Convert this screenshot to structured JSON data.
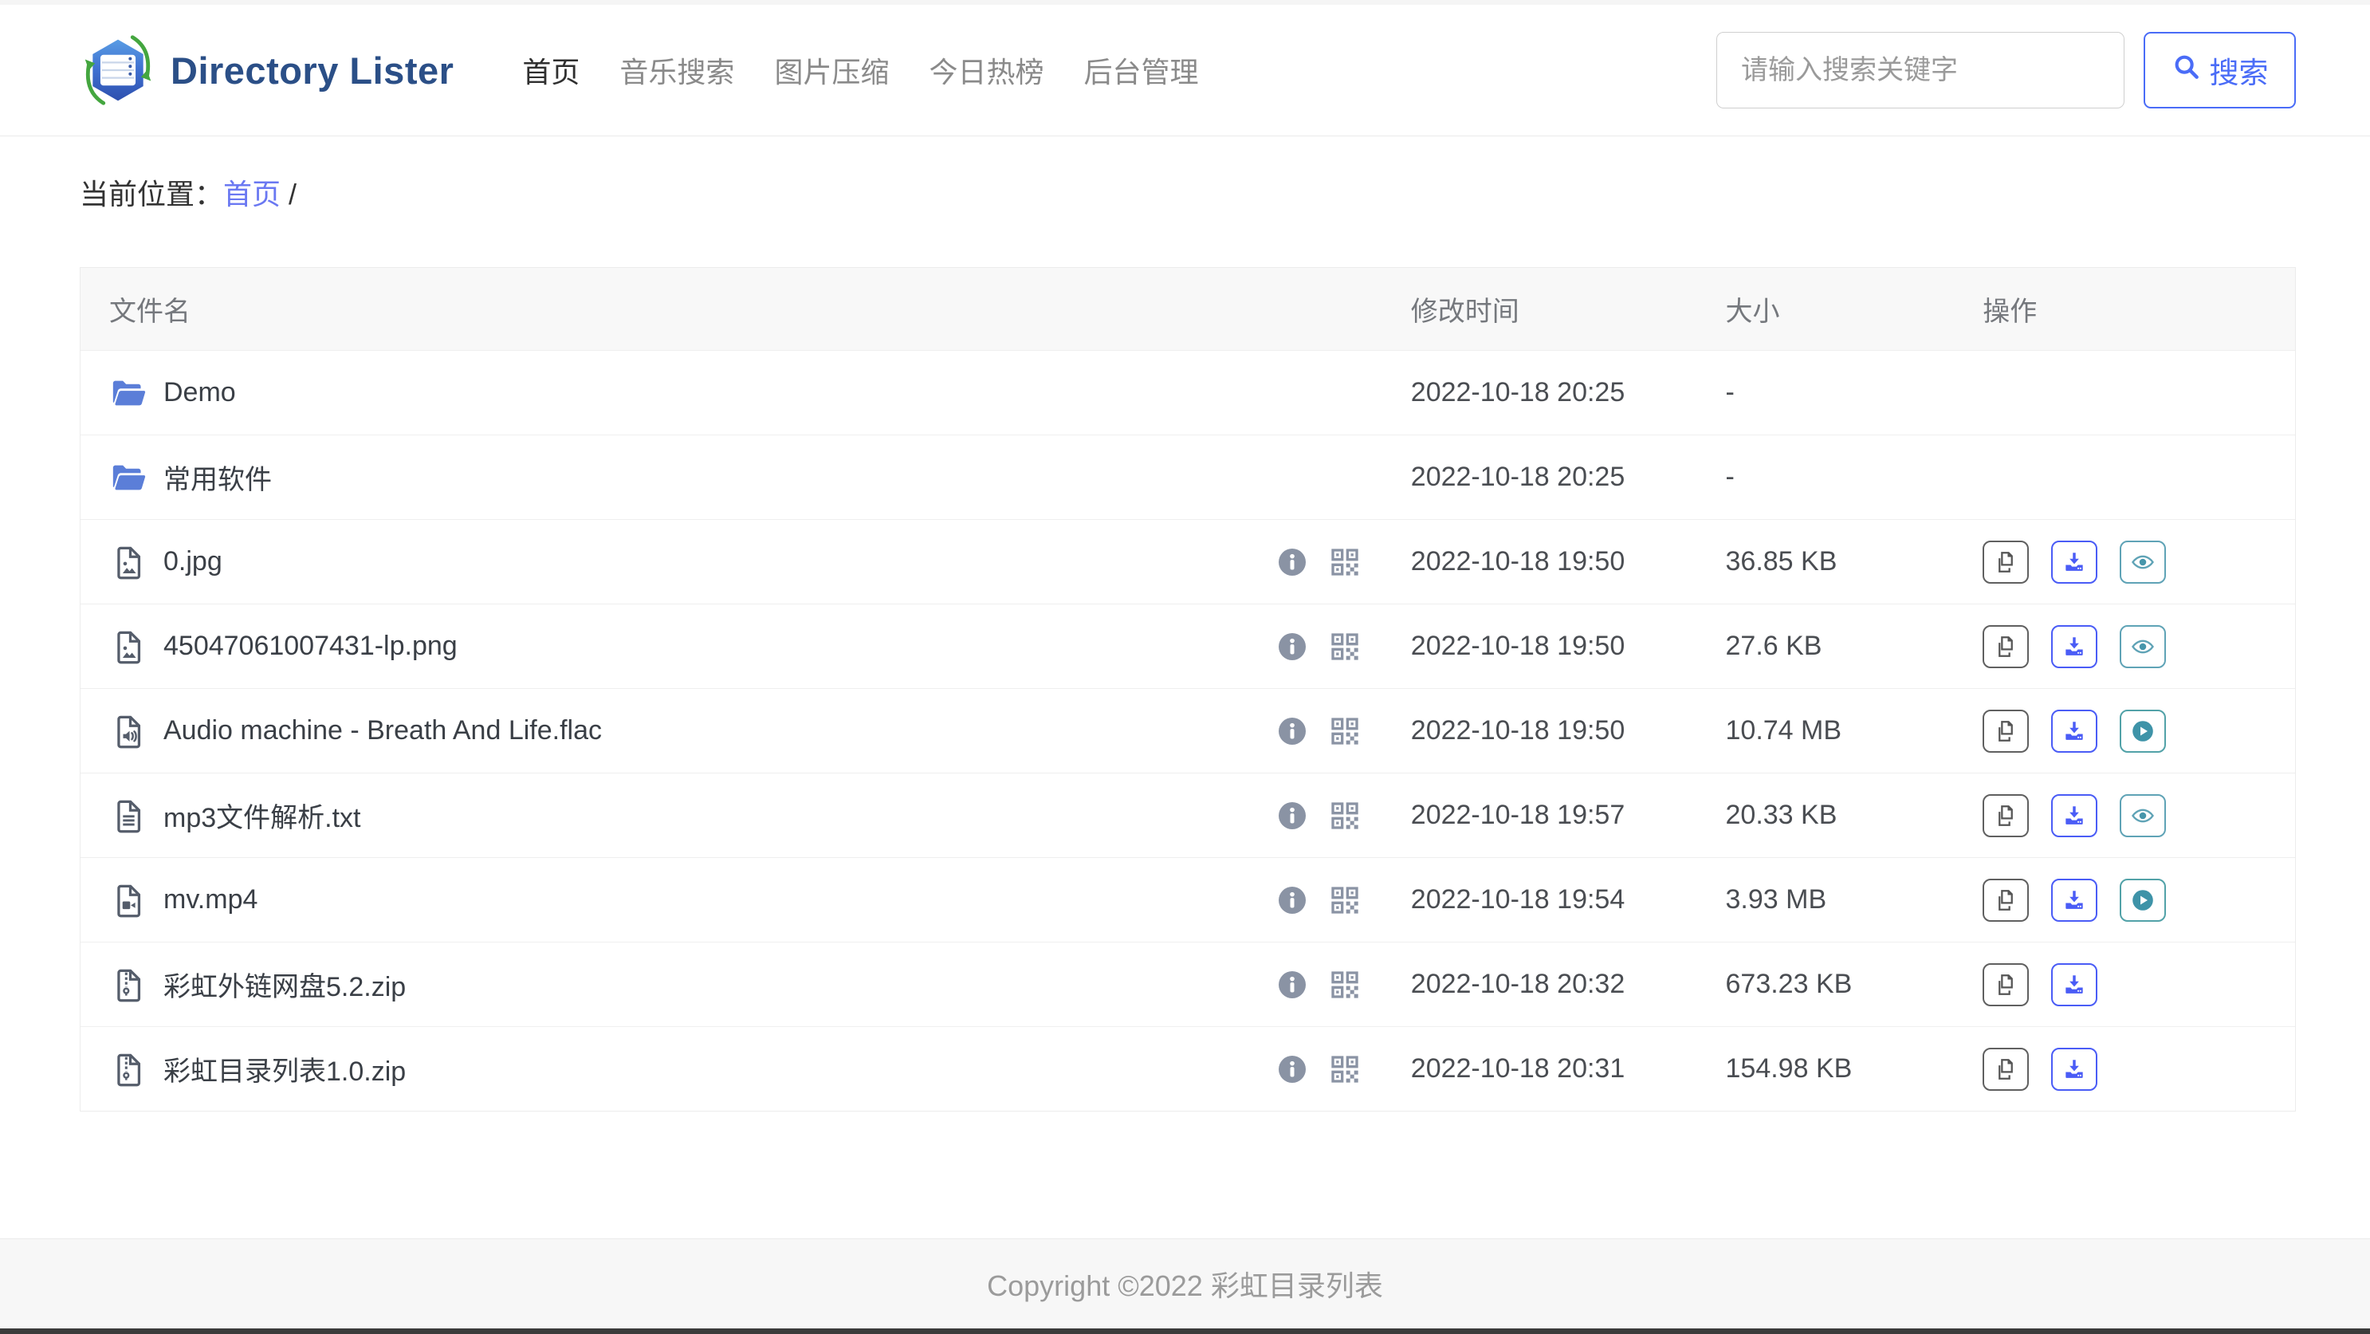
{
  "brand": {
    "name": "Directory Lister"
  },
  "nav": {
    "items": [
      {
        "label": "首页",
        "name": "nav-item-home",
        "active": true
      },
      {
        "label": "音乐搜索",
        "name": "nav-item-music-search",
        "active": false
      },
      {
        "label": "图片压缩",
        "name": "nav-item-image-compress",
        "active": false
      },
      {
        "label": "今日热榜",
        "name": "nav-item-hot-list",
        "active": false
      },
      {
        "label": "后台管理",
        "name": "nav-item-admin",
        "active": false
      }
    ]
  },
  "search": {
    "placeholder": "请输入搜索关键字",
    "button_label": "搜索"
  },
  "breadcrumb": {
    "prefix": "当前位置：",
    "home": "首页",
    "separator": "/"
  },
  "table": {
    "headers": {
      "name": "文件名",
      "modified": "修改时间",
      "size": "大小",
      "actions": "操作"
    },
    "rows": [
      {
        "icon": "folder",
        "name": "Demo",
        "modified": "2022-10-18 20:25",
        "size": "-",
        "badges": false,
        "actions": []
      },
      {
        "icon": "folder",
        "name": "常用软件",
        "modified": "2022-10-18 20:25",
        "size": "-",
        "badges": false,
        "actions": []
      },
      {
        "icon": "image",
        "name": "0.jpg",
        "modified": "2022-10-18 19:50",
        "size": "36.85 KB",
        "badges": true,
        "actions": [
          "copy",
          "download",
          "view"
        ]
      },
      {
        "icon": "image",
        "name": "45047061007431-lp.png",
        "modified": "2022-10-18 19:50",
        "size": "27.6 KB",
        "badges": true,
        "actions": [
          "copy",
          "download",
          "view"
        ]
      },
      {
        "icon": "audio",
        "name": "Audio machine - Breath And Life.flac",
        "modified": "2022-10-18 19:50",
        "size": "10.74 MB",
        "badges": true,
        "actions": [
          "copy",
          "download",
          "play"
        ]
      },
      {
        "icon": "text",
        "name": "mp3文件解析.txt",
        "modified": "2022-10-18 19:57",
        "size": "20.33 KB",
        "badges": true,
        "actions": [
          "copy",
          "download",
          "view"
        ]
      },
      {
        "icon": "video",
        "name": "mv.mp4",
        "modified": "2022-10-18 19:54",
        "size": "3.93 MB",
        "badges": true,
        "actions": [
          "copy",
          "download",
          "play"
        ]
      },
      {
        "icon": "zip",
        "name": "彩虹外链网盘5.2.zip",
        "modified": "2022-10-18 20:32",
        "size": "673.23 KB",
        "badges": true,
        "actions": [
          "copy",
          "download"
        ]
      },
      {
        "icon": "zip",
        "name": "彩虹目录列表1.0.zip",
        "modified": "2022-10-18 20:31",
        "size": "154.98 KB",
        "badges": true,
        "actions": [
          "copy",
          "download"
        ]
      }
    ]
  },
  "footer": {
    "copyright": "Copyright ©2022 彩虹目录列表"
  },
  "colors": {
    "accent_blue": "#4a6cf7",
    "link_blue": "#6a78f2",
    "brand_navy": "#2b4f87",
    "folder_blue": "#5b7ed8",
    "file_icon_gray": "#555d6b",
    "badge_gray": "#8a93a4",
    "teal": "#4796ab",
    "header_bg": "#f8f8f8",
    "footer_bg": "#f7f7f7"
  }
}
